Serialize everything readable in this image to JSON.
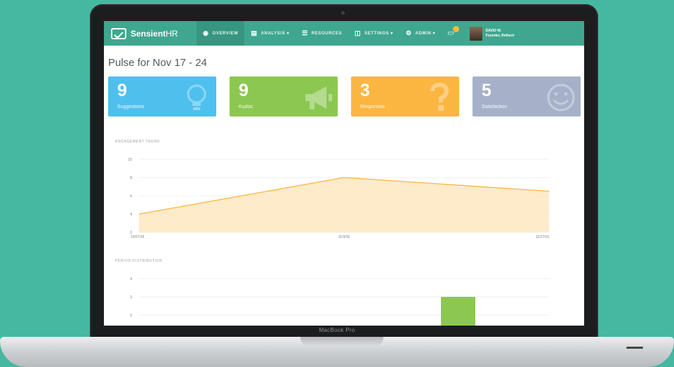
{
  "device": {
    "model_label": "MacBook Pro"
  },
  "app": {
    "brand_bold": "Sensient",
    "brand_thin": "HR",
    "accent_color": "#3fa78f"
  },
  "nav": {
    "items": [
      {
        "label": "OVERVIEW",
        "icon": "dashboard-icon",
        "active": true
      },
      {
        "label": "ANALYSIS ▾",
        "icon": "bar-chart-icon",
        "active": false
      },
      {
        "label": "RESOURCES",
        "icon": "book-icon",
        "active": false
      },
      {
        "label": "SETTINGS ▾",
        "icon": "sliders-icon",
        "active": false
      },
      {
        "label": "ADMIN ▾",
        "icon": "gear-icon",
        "active": false
      }
    ],
    "user": {
      "name": "DAVID W.",
      "sub": "Founder, Reflectr"
    }
  },
  "page": {
    "title": "Pulse for Nov 17 - 24"
  },
  "cards": [
    {
      "value": "9",
      "label": "Suggestions",
      "color": "#4fc0ee",
      "icon": "lightbulb-icon"
    },
    {
      "value": "9",
      "label": "Kudos",
      "color": "#8cc851",
      "icon": "megaphone-icon"
    },
    {
      "value": "3",
      "label": "Responses",
      "color": "#fbb642",
      "icon": "question-mark-icon"
    },
    {
      "value": "5",
      "label": "Satisfaction",
      "color": "#a6b1c9",
      "icon": "smiley-icon"
    }
  ],
  "trend": {
    "label": "ENGAGEMENT TREND",
    "chart_data": {
      "type": "area",
      "x": [
        "10/27/16",
        "11/3/16",
        "11/17/16"
      ],
      "values": [
        4,
        8,
        6.5
      ],
      "ylim": [
        2,
        10
      ],
      "yticks": [
        "10",
        "8",
        "6",
        "4",
        "2"
      ],
      "grid": true,
      "color": "#fbb642"
    }
  },
  "distribution": {
    "label": "PERIOD DISTRIBUTION",
    "chart_data": {
      "type": "bar",
      "yticks": [
        "4",
        "3",
        "2"
      ],
      "bar_value": 3,
      "ylim": [
        2,
        4
      ],
      "color": "#8cc851",
      "grid": true
    }
  }
}
